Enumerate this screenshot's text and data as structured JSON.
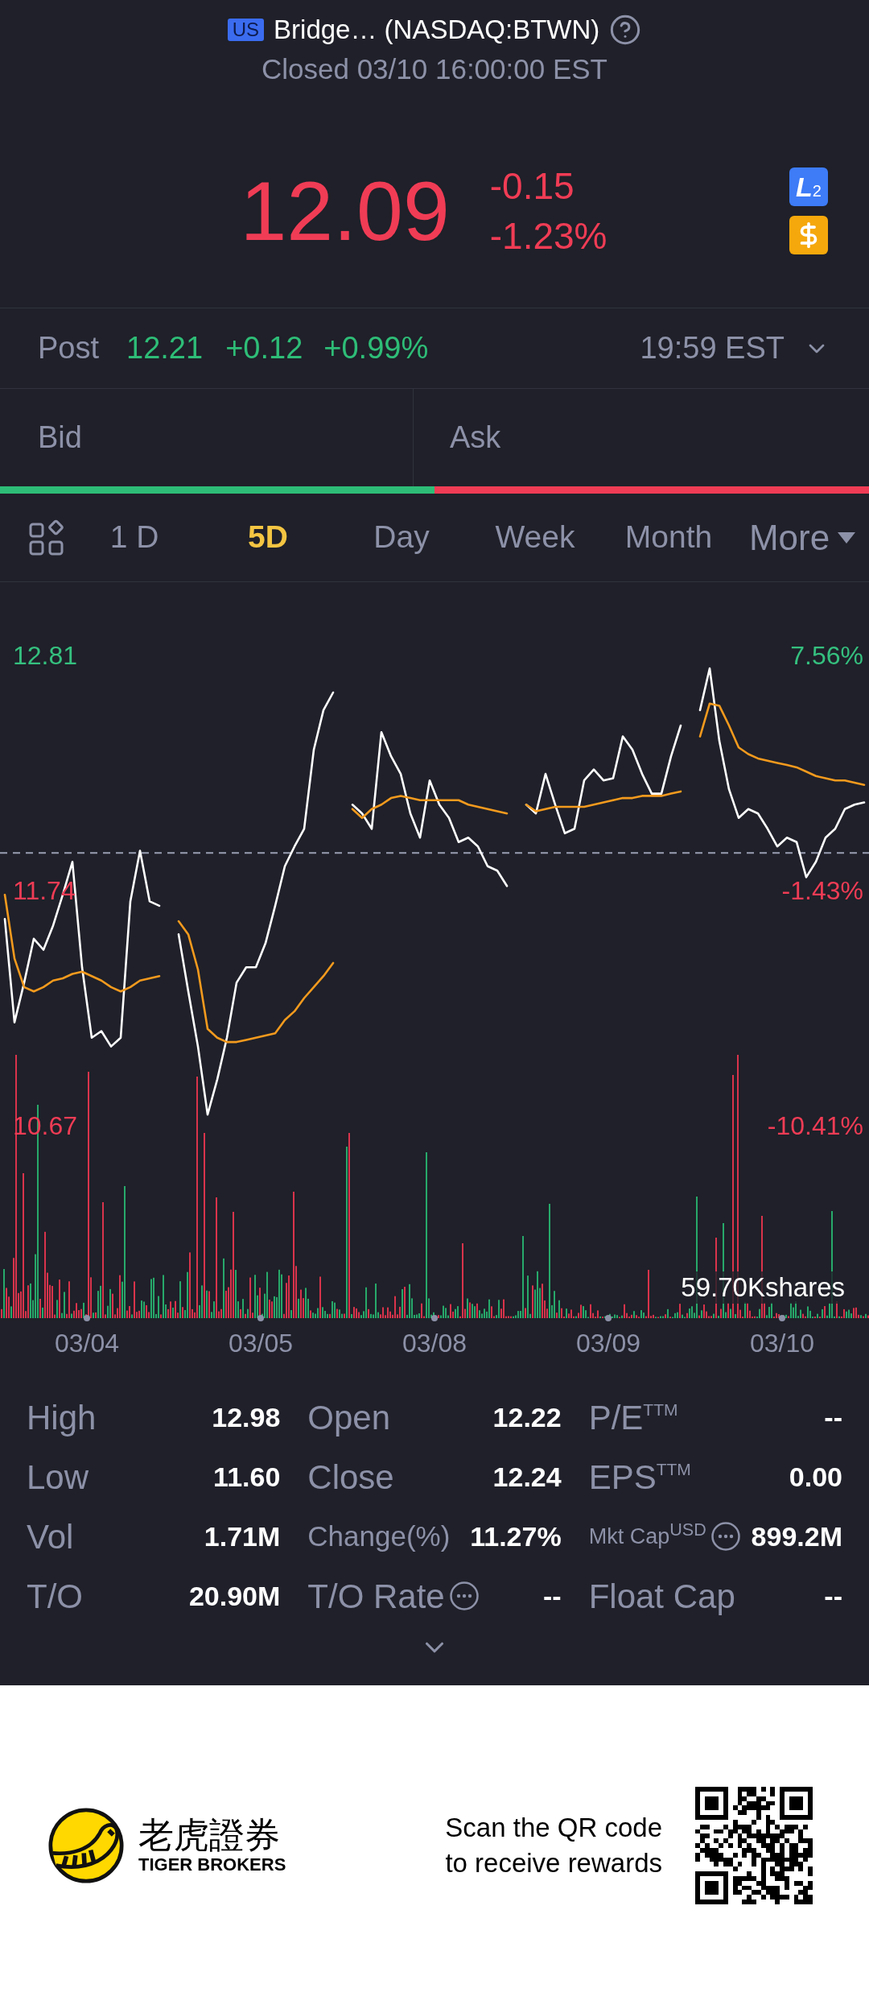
{
  "header": {
    "market_badge": "US",
    "title": "Bridge… (NASDAQ:BTWN)",
    "status": "Closed 03/10 16:00:00 EST",
    "price": "12.09",
    "change": "-0.15",
    "change_percent": "-1.23%",
    "rising": false,
    "level2_badge": "L$_{2}$"
  },
  "post_market": {
    "label": "Post",
    "price": "12.21",
    "change": "+0.12",
    "change_percent": "+0.99%",
    "rising": true,
    "time": "19:59 EST"
  },
  "order_book": {
    "bid_label": "Bid",
    "ask_label": "Ask",
    "level": 0.5
  },
  "period_tabs": [
    {
      "label": "1 D",
      "selected": false,
      "kind": "tab"
    },
    {
      "label": "5D",
      "selected": true,
      "kind": "tab"
    },
    {
      "label": "Day",
      "selected": false,
      "kind": "tab"
    },
    {
      "label": "Week",
      "selected": false,
      "kind": "tab"
    },
    {
      "label": "Month",
      "selected": false,
      "kind": "tab"
    },
    {
      "label": "More",
      "selected": false,
      "kind": "menu"
    }
  ],
  "chart": {
    "chart_data": {
      "type": "line",
      "series": [
        {
          "color": "#ffffff",
          "values": [
            11.61,
            11.14,
            11.32,
            11.52,
            11.47,
            11.58,
            11.72,
            11.87,
            11.39,
            11.07,
            11.1,
            11.03,
            11.07,
            11.69,
            11.92,
            11.69,
            11.67,
            null,
            11.54,
            11.28,
            11.03,
            10.72,
            10.88,
            11.07,
            11.32,
            11.39,
            11.39,
            11.5,
            11.67,
            11.85,
            11.94,
            12.02,
            12.38,
            12.56,
            12.64,
            null,
            12.13,
            12.09,
            12.02,
            12.46,
            12.35,
            12.27,
            12.09,
            11.98,
            12.24,
            12.13,
            12.07,
            11.96,
            11.98,
            11.94,
            11.85,
            11.83,
            11.76,
            null,
            12.13,
            12.09,
            12.27,
            12.13,
            12.0,
            12.02,
            12.24,
            12.29,
            12.24,
            12.25,
            12.44,
            12.38,
            12.27,
            12.18,
            12.18,
            12.35,
            12.49,
            null,
            12.56,
            12.75,
            12.42,
            12.2,
            12.07,
            12.11,
            12.09,
            12.02,
            11.94,
            11.98,
            11.96,
            11.8,
            11.87,
            11.98,
            12.02,
            12.11,
            12.13,
            12.14
          ]
        },
        {
          "color": "#f39a1e",
          "values": [
            11.72,
            11.43,
            11.3,
            11.28,
            11.3,
            11.33,
            11.34,
            11.36,
            11.37,
            11.35,
            11.33,
            11.3,
            11.28,
            11.3,
            11.33,
            11.34,
            11.35,
            null,
            11.6,
            11.54,
            11.38,
            11.11,
            11.07,
            11.05,
            11.05,
            11.06,
            11.07,
            11.08,
            11.09,
            11.15,
            11.19,
            11.25,
            11.3,
            11.35,
            11.41,
            null,
            12.11,
            12.07,
            12.11,
            12.13,
            12.16,
            12.17,
            12.16,
            12.15,
            12.15,
            12.15,
            12.15,
            12.15,
            12.13,
            12.12,
            12.11,
            12.1,
            12.09,
            null,
            12.13,
            12.1,
            12.11,
            12.12,
            12.12,
            12.12,
            12.12,
            12.13,
            12.14,
            12.15,
            12.16,
            12.16,
            12.17,
            12.17,
            12.17,
            12.18,
            12.19,
            null,
            12.44,
            12.59,
            12.58,
            12.49,
            12.39,
            12.36,
            12.34,
            12.33,
            12.32,
            12.31,
            12.3,
            12.28,
            12.26,
            12.25,
            12.24,
            12.24,
            12.23,
            12.22
          ]
        }
      ],
      "ylim": [
        6.67,
        15.79
      ],
      "yticks": [
        {
          "value": 12.81,
          "label": "12.81"
        },
        {
          "value": 11.74,
          "label": "11.74"
        },
        {
          "value": 10.67,
          "label": "10.67"
        }
      ],
      "ref_lines": [
        {
          "axis": "y",
          "value": 11.91
        }
      ]
    },
    "percent_labels": [
      "7.56%",
      "-1.43%",
      "-10.41%"
    ],
    "date_labels": [
      "03/04",
      "03/05",
      "03/08",
      "03/09",
      "03/10"
    ],
    "volume_label": "59.70Kshares"
  },
  "stats": {
    "rows": [
      {
        "cells": [
          {
            "label": "High",
            "value": "12.98",
            "kind": "plain"
          },
          {
            "label": "Open",
            "value": "12.22",
            "kind": "plain"
          },
          {
            "label": "P/E$^{TTM}$",
            "value": "--",
            "kind": "plain"
          }
        ]
      },
      {
        "cells": [
          {
            "label": "Low",
            "value": "11.60",
            "kind": "plain"
          },
          {
            "label": "Close",
            "value": "12.24",
            "kind": "plain"
          },
          {
            "label": "EPS$^{TTM}$",
            "value": "0.00",
            "kind": "plain"
          }
        ]
      },
      {
        "cells": [
          {
            "label": "Vol",
            "value": "1.71M",
            "kind": "plain"
          },
          {
            "label": "Change(%)",
            "value": "11.27%",
            "kind": "plain"
          },
          {
            "label": "Mkt Cap$^{USD}$",
            "value": "899.2M",
            "kind": "info"
          }
        ]
      },
      {
        "cells": [
          {
            "label": "T/O",
            "value": "20.90M",
            "kind": "plain"
          },
          {
            "label": "T/O Rate",
            "value": "--",
            "kind": "info"
          },
          {
            "label": "Float Cap",
            "value": "--",
            "kind": "plain"
          }
        ]
      }
    ]
  },
  "footer": {
    "brand_name": "老虎證券",
    "brand_subtitle": "TIGER BROKERS",
    "cta": "Scan the QR code to receive rewards"
  }
}
